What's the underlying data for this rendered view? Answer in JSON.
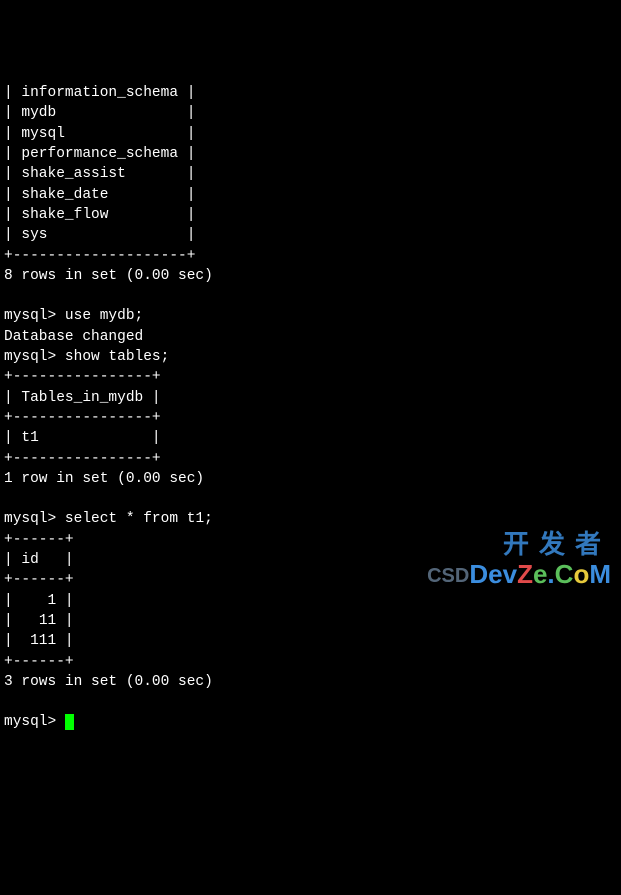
{
  "databases": {
    "rows": [
      "information_schema",
      "mydb",
      "mysql",
      "performance_schema",
      "shake_assist",
      "shake_date",
      "shake_flow",
      "sys"
    ],
    "border_top": "+--------------------+",
    "footer": "8 rows in set (0.00 sec)"
  },
  "prompt": "mysql>",
  "cmd_use": "use mydb;",
  "use_response": "Database changed",
  "cmd_show_tables": "show tables;",
  "tables": {
    "border": "+----------------+",
    "header_label": "Tables_in_mydb",
    "rows": [
      "t1"
    ],
    "footer": "1 row in set (0.00 sec)"
  },
  "cmd_select": "select * from t1;",
  "select_result": {
    "border": "+------+",
    "header_label": "id",
    "rows": [
      "1",
      "11",
      "111"
    ],
    "footer": "3 rows in set (0.00 sec)"
  },
  "watermark": {
    "cn": "开发者",
    "csd": "CSD",
    "d": "D",
    "e1": "e",
    "v": "v",
    "z": "Z",
    "e2": "e",
    "dot": ".",
    "c": "C",
    "o": "o",
    "m": "M"
  }
}
